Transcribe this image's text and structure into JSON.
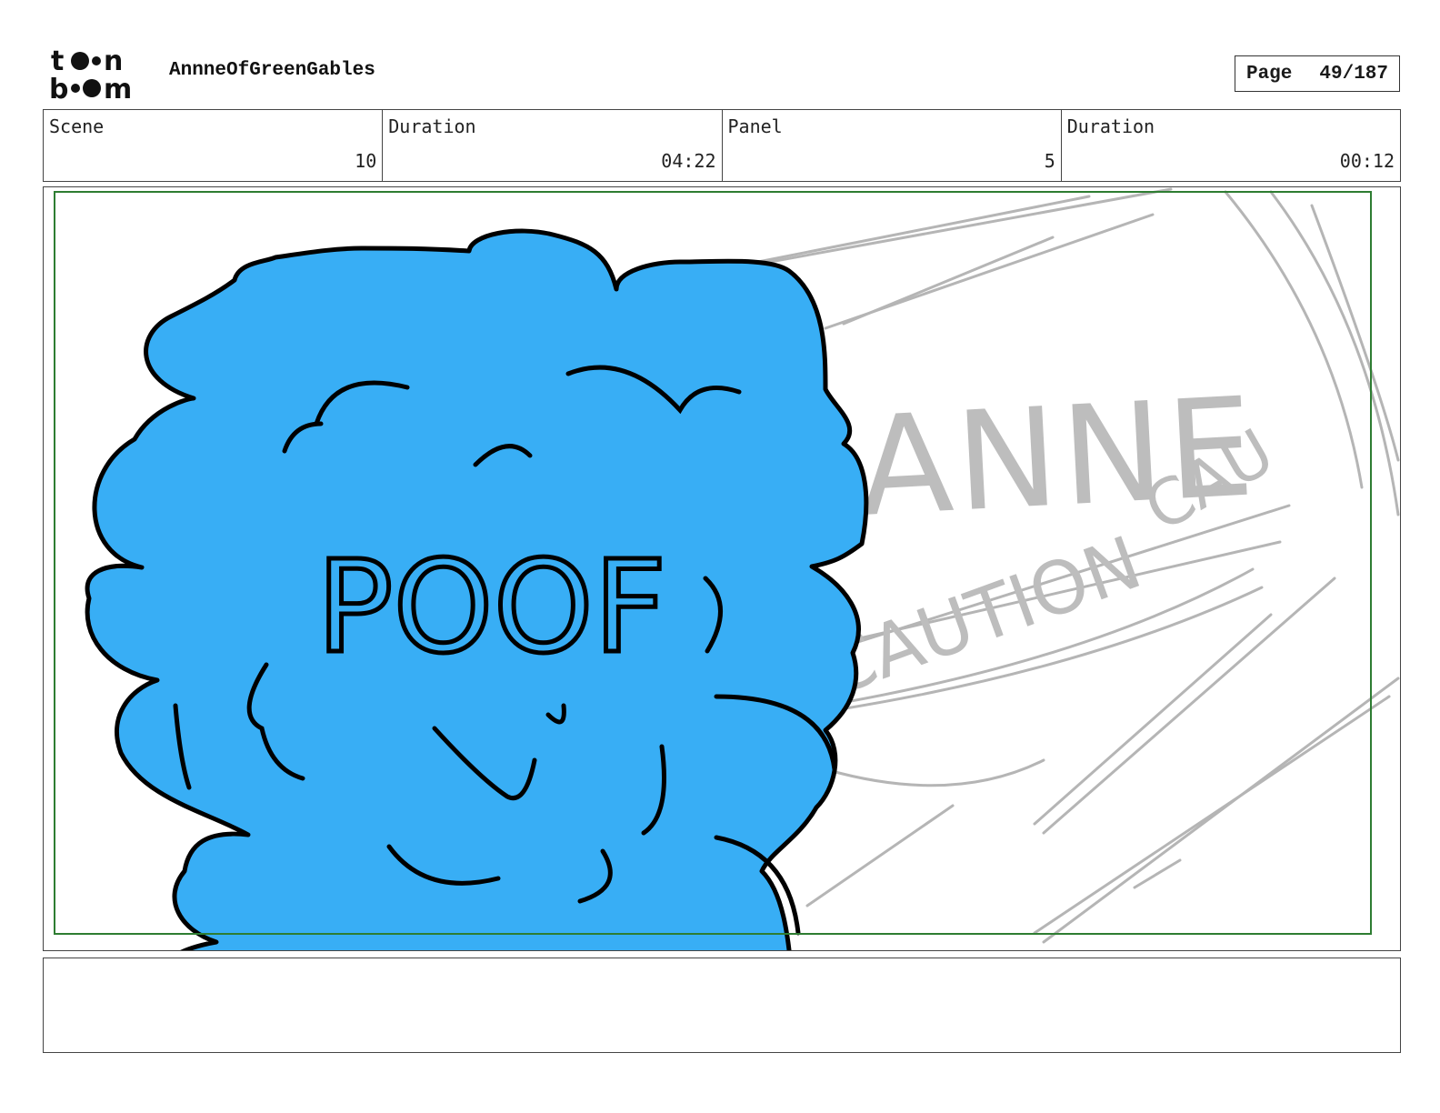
{
  "header": {
    "logo_alt": "toon boom",
    "project_title": "AnnneOfGreenGables",
    "page_label": "Page",
    "page_number": "49/187"
  },
  "info": {
    "scene_label": "Scene",
    "scene_value": "10",
    "scene_duration_label": "Duration",
    "scene_duration_value": "04:22",
    "panel_label": "Panel",
    "panel_value": "5",
    "panel_duration_label": "Duration",
    "panel_duration_value": "00:12"
  },
  "panel": {
    "caption": "POOF",
    "background_sketch_lines": [
      "ANNE",
      "CAUTION",
      "CAU"
    ]
  },
  "notes": {
    "text": ""
  },
  "colors": {
    "cloud_fill": "#38aef5",
    "sketch_gray": "#b5b5b5",
    "safe_frame_green": "#2e7d32",
    "ink": "#000000"
  }
}
